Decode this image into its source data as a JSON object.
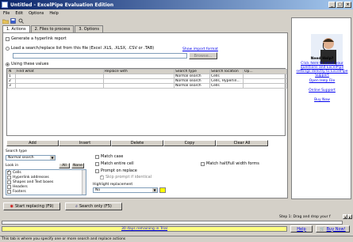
{
  "window": {
    "title": "Untitled - ExcelPipe Evaluation Edition",
    "controls": [
      "_",
      "□",
      "×"
    ]
  },
  "menu": [
    "File",
    "Edit",
    "Options",
    "Help"
  ],
  "toolbar": {
    "icons": [
      "open-folder-icon",
      "save-icon",
      "search-icon"
    ]
  },
  "tabs": [
    {
      "label": "1. Actions",
      "active": true
    },
    {
      "label": "2. Files to process",
      "active": false
    },
    {
      "label": "3. Options",
      "active": false
    }
  ],
  "actions": {
    "generate_report_label": "Generate a hyperlink report",
    "load_label": "Load a search/replace list from this file (Excel .XLS, .XLSX, .CSV or .TAB)",
    "show_import_format": "Show import format",
    "browse_label": "Browse...",
    "use_values_label": "Using these values"
  },
  "grid": {
    "columns": [
      "N",
      "Find what",
      "Replace with",
      "Search type",
      "Search location",
      "Op..."
    ],
    "rows": [
      [
        "1",
        "",
        "",
        "Normal search",
        "Cells",
        ""
      ],
      [
        "2",
        "",
        "",
        "Normal search",
        "Cells, Hyperlin...",
        ""
      ],
      [
        "3",
        "",
        "",
        "Normal search",
        "Cells",
        ""
      ]
    ]
  },
  "grid_buttons": [
    "Add",
    "Insert",
    "Delete",
    "Copy",
    "Clear All"
  ],
  "search_type": {
    "label": "Search type",
    "value": "Normal search"
  },
  "look_in": {
    "label": "Look in",
    "all_label": "All",
    "none_label": "None",
    "items": [
      {
        "label": "Cells",
        "checked": true
      },
      {
        "label": "Hyperlink addresses",
        "checked": false
      },
      {
        "label": "Shapes and Text boxes",
        "checked": false
      },
      {
        "label": "Headers",
        "checked": false
      },
      {
        "label": "Footers",
        "checked": false
      }
    ]
  },
  "options": {
    "match_case": "Match case",
    "match_entire_cell": "Match entire cell",
    "prompt_on_replace": "Prompt on replace",
    "skip_prompt": "Skip prompt if identical",
    "highlight_label": "Highlight replacement",
    "highlight_value": "No",
    "match_half_full": "Match half/full width forms"
  },
  "colors": {
    "highlight_swatch": "#ffff00",
    "progress_bg": "#ffff80",
    "link": "#0000ee"
  },
  "sidebar": {
    "need_help": "Need Help?",
    "click_here": "Click here to email your questions and ExcelPipe settings directly to ExcelPipe Support",
    "open_help": "Open Help File",
    "online_support": "Online Support",
    "buy_now": "Buy Now"
  },
  "actions_bar": {
    "start_replacing": "Start replacing (F9)",
    "search_only": "Search only (F5)",
    "step_text": "Step 1: Drag and drop your f"
  },
  "bottom": {
    "trial_text": "30 days remaining in Trial",
    "help_btn": "Help",
    "buy_btn": "Buy Now!"
  },
  "status": "This tab is where you specify one or more search and replace actions"
}
